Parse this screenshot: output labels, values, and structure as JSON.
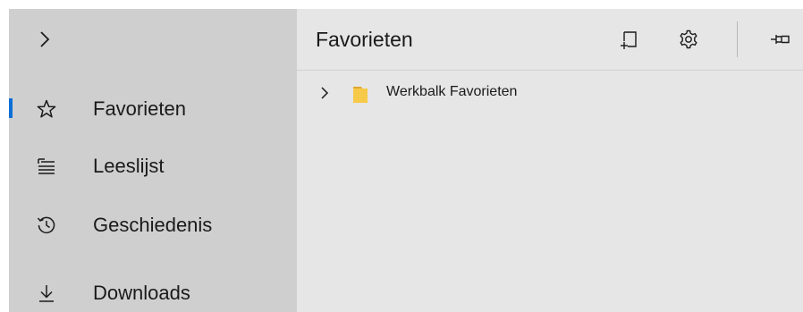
{
  "rail": {
    "toggle_icon": "chevron-right-icon",
    "items": [
      {
        "label": "Favorieten",
        "icon": "star-icon",
        "selected": true
      },
      {
        "label": "Leeslijst",
        "icon": "reading-list-icon",
        "selected": false
      },
      {
        "label": "Geschiedenis",
        "icon": "history-icon",
        "selected": false
      },
      {
        "label": "Downloads",
        "icon": "download-icon",
        "selected": false
      }
    ]
  },
  "pane": {
    "title": "Favorieten",
    "buttons": [
      {
        "name": "add-to-favorites",
        "icon": "add-page-icon"
      },
      {
        "name": "settings",
        "icon": "gear-icon"
      },
      {
        "name": "pin",
        "icon": "pin-icon"
      }
    ],
    "tree": [
      {
        "label": "Werkbalk Favorieten",
        "icon": "folder-icon",
        "expanded": false
      }
    ]
  },
  "colors": {
    "rail_bg": "#cfcfcf",
    "pane_bg": "#e6e6e6",
    "accent": "#0a6fd6",
    "folder": "#f7c948"
  }
}
